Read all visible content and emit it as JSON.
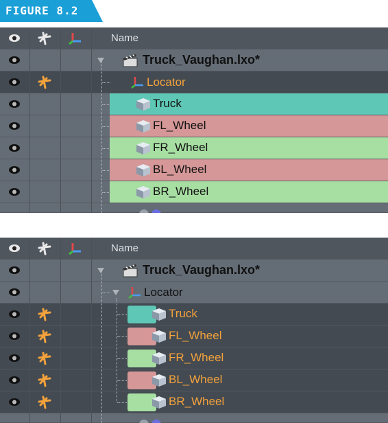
{
  "figure_label": "FIGURE 8.2",
  "colors": {
    "tag_blue": "#1b9fd7",
    "row_teal": "#5fc7b6",
    "row_pink": "#d59797",
    "row_green": "#a7dfa3",
    "orange_text": "#f4a23b",
    "panel_bg": "#646c75",
    "selected_bg": "#434a52"
  },
  "panel1": {
    "header": {
      "name_label": "Name"
    },
    "rows": [
      {
        "label": "Truck_Vaughan.lxo*",
        "icon": "clapperboard-icon",
        "style": "scene"
      },
      {
        "label": "Locator",
        "icon": "locator-axis-icon",
        "style": "selected-orange"
      },
      {
        "label": "Truck",
        "icon": "mesh-cube-icon",
        "style": "teal"
      },
      {
        "label": "FL_Wheel",
        "icon": "mesh-cube-icon",
        "style": "pink"
      },
      {
        "label": "FR_Wheel",
        "icon": "mesh-cube-icon",
        "style": "green"
      },
      {
        "label": "BL_Wheel",
        "icon": "mesh-cube-icon",
        "style": "pink"
      },
      {
        "label": "BR_Wheel",
        "icon": "mesh-cube-icon",
        "style": "green"
      }
    ]
  },
  "panel2": {
    "header": {
      "name_label": "Name"
    },
    "rows": [
      {
        "label": "Truck_Vaughan.lxo*",
        "icon": "clapperboard-icon",
        "style": "scene"
      },
      {
        "label": "Locator",
        "icon": "locator-axis-icon",
        "style": "normal"
      },
      {
        "label": "Truck",
        "icon": "mesh-cube-icon",
        "style": "selected",
        "swatch": "teal"
      },
      {
        "label": "FL_Wheel",
        "icon": "mesh-cube-icon",
        "style": "selected",
        "swatch": "pink"
      },
      {
        "label": "FR_Wheel",
        "icon": "mesh-cube-icon",
        "style": "selected",
        "swatch": "green"
      },
      {
        "label": "BL_Wheel",
        "icon": "mesh-cube-icon",
        "style": "selected",
        "swatch": "pink"
      },
      {
        "label": "BR_Wheel",
        "icon": "mesh-cube-icon",
        "style": "selected",
        "swatch": "green"
      }
    ]
  }
}
